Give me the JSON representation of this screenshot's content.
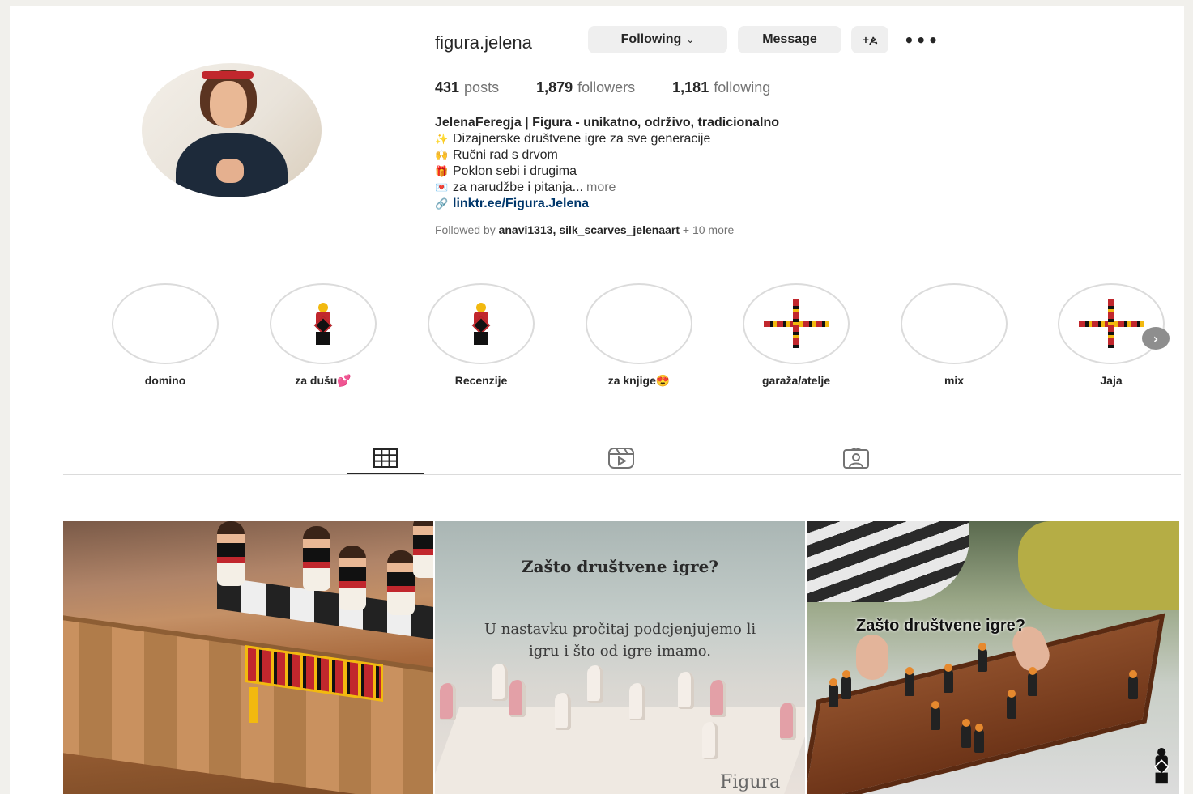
{
  "profile": {
    "username": "figura.jelena",
    "following_label": "Following",
    "message_label": "Message",
    "add_user_glyph": "+ዾ",
    "more_glyph": "•••",
    "stats": {
      "posts_num": "431",
      "posts_label": "posts",
      "followers_num": "1,879",
      "followers_label": "followers",
      "following_num": "1,181",
      "following_label": "following"
    },
    "bio": {
      "name": "JelenaFeregja | Figura - unikatno, održivo, tradicionalno",
      "line1_emoji": "✨",
      "line1": "Dizajnerske društvene igre za sve generacije",
      "line2_emoji": "🙌",
      "line2": "Ručni rad s drvom",
      "line3_emoji": "🎁",
      "line3": "Poklon sebi i drugima",
      "line4_emoji": "💌",
      "line4": "za narudžbe i pitanja...",
      "more": "more",
      "link_glyph": "🔗",
      "link": "linktr.ee/Figura.Jelena"
    },
    "followed_by": {
      "prefix": "Followed by",
      "users": "anavi1313, silk_scarves_jelenaart",
      "suffix": "+ 10 more"
    }
  },
  "highlights": [
    {
      "label": "domino"
    },
    {
      "label": "za dušu💕"
    },
    {
      "label": "Recenzije"
    },
    {
      "label": "za knjige😍"
    },
    {
      "label": "garaža/atelje"
    },
    {
      "label": "mix"
    },
    {
      "label": "Jaja"
    }
  ],
  "highlights_next_glyph": "›",
  "tabs": [
    {
      "name": "posts",
      "icon": "grid-icon",
      "active": true
    },
    {
      "name": "reels",
      "icon": "reels-icon",
      "active": false
    },
    {
      "name": "tagged",
      "icon": "tagged-icon",
      "active": false
    }
  ],
  "posts": {
    "p2_title": "Zašto društvene igre?",
    "p2_body": "U nastavku pročitaj podcjenjujemo li igru i što od igre imamo.",
    "p2_logo": "Figura",
    "p3_title": "Zašto društvene igre?"
  },
  "colors": {
    "accent_red": "#c1272d",
    "accent_yellow": "#f2b90f",
    "link_blue": "#00376b",
    "muted": "#737373"
  }
}
